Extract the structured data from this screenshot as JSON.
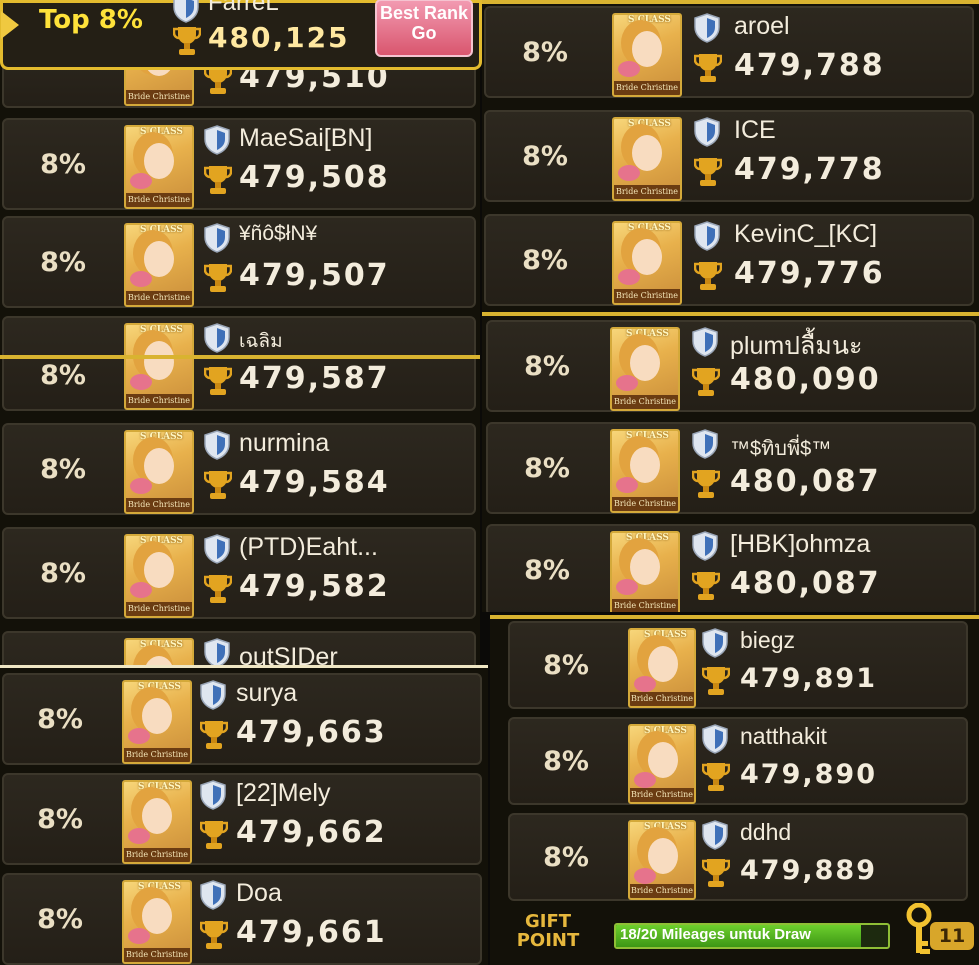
{
  "header": {
    "top_label": "Top 8%",
    "player_name": "FarreL",
    "player_score": "480,125",
    "best_rank_label_1": "Best Rank",
    "best_rank_label_2": "Go"
  },
  "card_caption": "Bride Christine",
  "card_class": "S CLASS",
  "left_entries": [
    {
      "percent": "",
      "name": "",
      "score": "479,510"
    },
    {
      "percent": "8%",
      "name": "MaeSai[BN]",
      "score": "479,508"
    },
    {
      "percent": "8%",
      "name": "¥ñô$łN¥",
      "score": "479,507"
    },
    {
      "percent": "",
      "name": "เฉลิม",
      "score": ""
    },
    {
      "percent": "8%",
      "name": "",
      "score": "479,587"
    },
    {
      "percent": "8%",
      "name": "nurmina",
      "score": "479,584"
    },
    {
      "percent": "8%",
      "name": "(PTD)Eaht...",
      "score": "479,582"
    },
    {
      "percent": "",
      "name": "outSIDer",
      "score": ""
    },
    {
      "percent": "8%",
      "name": "surya",
      "score": "479,663"
    },
    {
      "percent": "8%",
      "name": "[22]Mely",
      "score": "479,662"
    },
    {
      "percent": "8%",
      "name": "Doa",
      "score": "479,661"
    }
  ],
  "right_entries": [
    {
      "percent": "8%",
      "name": "aroel",
      "score": "479,788"
    },
    {
      "percent": "8%",
      "name": "ICE",
      "score": "479,778"
    },
    {
      "percent": "8%",
      "name": "KevinC_[KC]",
      "score": "479,776"
    },
    {
      "percent": "8%",
      "name": "plumปลื้มนะ",
      "score": "480,090"
    },
    {
      "percent": "8%",
      "name": "™$ทิบพี่$™",
      "score": "480,087"
    },
    {
      "percent": "8%",
      "name": "[HBK]ohmza",
      "score": "480,087"
    },
    {
      "percent": "8%",
      "name": "biegz",
      "score": "479,891"
    },
    {
      "percent": "8%",
      "name": "natthakit",
      "score": "479,890"
    },
    {
      "percent": "8%",
      "name": "ddhd",
      "score": "479,889"
    }
  ],
  "footer": {
    "gift_line1": "GIFT",
    "gift_line2": "POINT",
    "mileage_text": "18/20 Mileages untuk Draw",
    "mileage_progress": 0.9,
    "key_count": "11"
  },
  "colors": {
    "gold": "#d9b330",
    "percent_text": "#eadfc4",
    "top_label": "#ffe23a",
    "row_bg": "#2a251c",
    "shield_blue": "#3f70b8",
    "trophy_gold": "#e2a420"
  }
}
